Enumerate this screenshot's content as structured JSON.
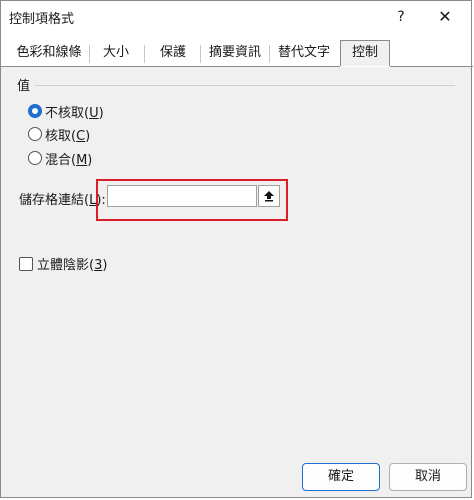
{
  "window": {
    "title": "控制項格式",
    "help_glyph": "?",
    "close_glyph": "✕"
  },
  "tabs": [
    {
      "label": "色彩和線條"
    },
    {
      "label": "大小"
    },
    {
      "label": "保護"
    },
    {
      "label": "摘要資訊"
    },
    {
      "label": "替代文字"
    },
    {
      "label": "控制",
      "active": true
    }
  ],
  "value_group": {
    "label": "值",
    "options": [
      {
        "text": "不核取(",
        "key": "U",
        "close": ")",
        "checked": true
      },
      {
        "text": "核取(",
        "key": "C",
        "close": ")",
        "checked": false
      },
      {
        "text": "混合(",
        "key": "M",
        "close": ")",
        "checked": false
      }
    ]
  },
  "cell_link": {
    "label_text": "儲存格連結(",
    "label_key": "L",
    "label_close": "):",
    "value": ""
  },
  "shading": {
    "text": "立體陰影(",
    "key": "3",
    "close": ")",
    "checked": false
  },
  "buttons": {
    "ok": "確定",
    "cancel": "取消"
  },
  "colors": {
    "accent": "#1f6fd1",
    "highlight": "#d81e2c"
  }
}
